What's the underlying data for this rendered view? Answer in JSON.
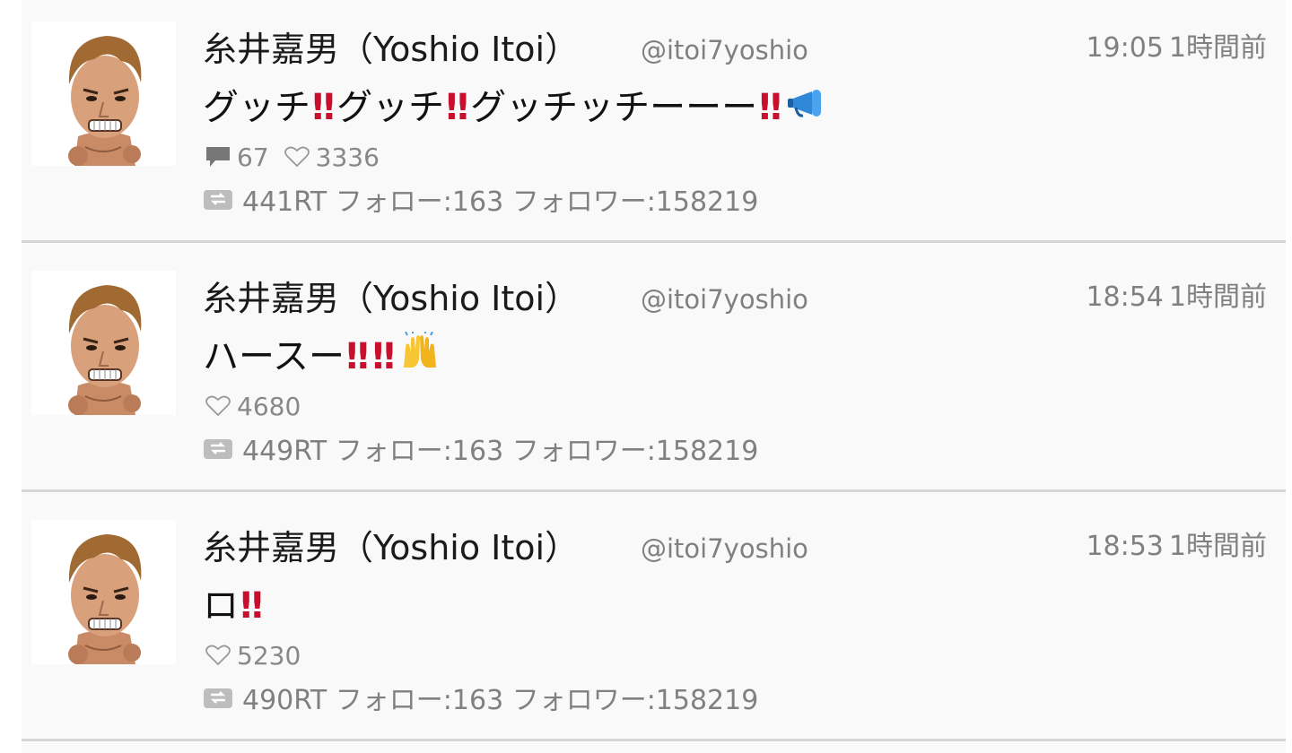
{
  "tweets": [
    {
      "name": "糸井嘉男（Yoshio Itoi）",
      "handle": "@itoi7yoshio",
      "time": "19:05",
      "time_ago": "1時間前",
      "text_parts": [
        "グッチ",
        "グッチ",
        "グッチッチーーー"
      ],
      "emoji_end": "megaphone-icon",
      "comments": "67",
      "likes": "3336",
      "meta": "441RT フォロー:163 フォロワー:158219"
    },
    {
      "name": "糸井嘉男（Yoshio Itoi）",
      "handle": "@itoi7yoshio",
      "time": "18:54",
      "time_ago": "1時間前",
      "text_parts": [
        "ハースー"
      ],
      "emoji_end": "raised-hands-icon",
      "likes": "4680",
      "meta": "449RT フォロー:163 フォロワー:158219"
    },
    {
      "name": "糸井嘉男（Yoshio Itoi）",
      "handle": "@itoi7yoshio",
      "time": "18:53",
      "time_ago": "1時間前",
      "text_parts": [
        "ロ"
      ],
      "likes": "5230",
      "meta": "490RT フォロー:163 フォロワー:158219"
    }
  ],
  "bang_mark": "‼",
  "colors": {
    "bang": "#c8102e",
    "meta_text": "#808080",
    "divider": "#d5d5d7",
    "background": "#f9f9fa"
  }
}
